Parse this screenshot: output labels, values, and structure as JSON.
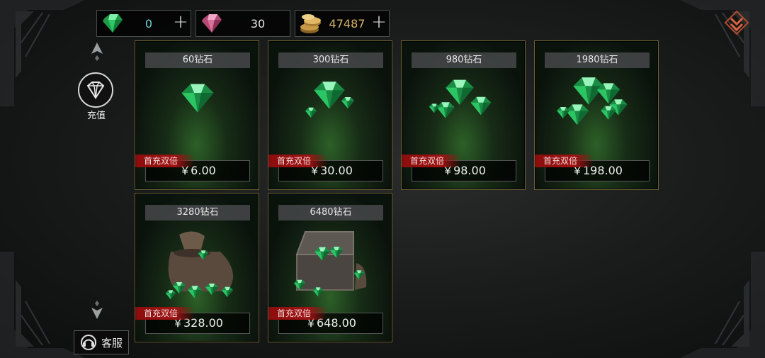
{
  "currency": {
    "emerald": {
      "value": "0",
      "icon": "green-diamond-icon",
      "color": "#6fd0d8"
    },
    "ruby": {
      "value": "30",
      "icon": "pink-diamond-icon",
      "color": "#e8e8e8"
    },
    "gold": {
      "value": "47487",
      "icon": "gold-coins-icon",
      "color": "#d9b36a"
    },
    "plus_label": "+"
  },
  "nav": {
    "recharge_label": "充值",
    "service_label": "客服"
  },
  "products": [
    {
      "title": "60钻石",
      "badge": "首充双倍",
      "price": "￥6.00",
      "art": "single-emerald"
    },
    {
      "title": "300钻石",
      "badge": "首充双倍",
      "price": "￥30.00",
      "art": "emeralds-small"
    },
    {
      "title": "980钻石",
      "badge": "首充双倍",
      "price": "￥98.00",
      "art": "emeralds-pile"
    },
    {
      "title": "1980钻石",
      "badge": "首充双倍",
      "price": "￥198.00",
      "art": "emeralds-big-pile"
    },
    {
      "title": "3280钻石",
      "badge": "首充双倍",
      "price": "￥328.00",
      "art": "emerald-sack"
    },
    {
      "title": "6480钻石",
      "badge": "首充双倍",
      "price": "￥648.00",
      "art": "emerald-chest"
    }
  ],
  "colors": {
    "card_border": "#6b6031",
    "badge_red": "#a01313",
    "emerald": "#2fb55a"
  }
}
